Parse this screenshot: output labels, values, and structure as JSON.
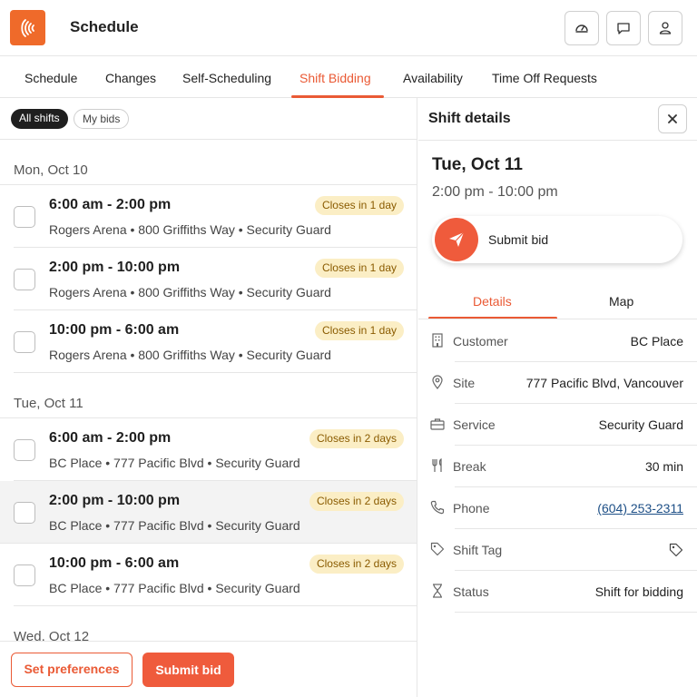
{
  "header": {
    "title": "Schedule",
    "brand_color": "#ef6a2a",
    "icons": [
      "dashboard-icon",
      "chat-icon",
      "profile-icon"
    ]
  },
  "tabs": [
    {
      "label": "Schedule",
      "active": false
    },
    {
      "label": "Changes",
      "active": false
    },
    {
      "label": "Self-Scheduling",
      "active": false
    },
    {
      "label": "Shift Bidding",
      "active": true
    },
    {
      "label": "Availability",
      "active": false
    },
    {
      "label": "Time Off Requests",
      "active": false
    }
  ],
  "filters": {
    "all_label": "All shifts",
    "mine_label": "My bids",
    "selected": "All shifts"
  },
  "days": [
    {
      "label": "Mon, Oct 10",
      "shifts": [
        {
          "time": "6:00 am - 2:00 pm",
          "meta": "Rogers Arena • 800 Griffiths Way • Security Guard",
          "badge": "Closes in 1 day",
          "selected": false
        },
        {
          "time": "2:00 pm - 10:00 pm",
          "meta": "Rogers Arena • 800 Griffiths Way • Security Guard",
          "badge": "Closes in 1 day",
          "selected": false
        },
        {
          "time": "10:00 pm - 6:00 am",
          "meta": "Rogers Arena • 800 Griffiths Way • Security Guard",
          "badge": "Closes in 1 day",
          "selected": false
        }
      ]
    },
    {
      "label": "Tue, Oct 11",
      "shifts": [
        {
          "time": "6:00 am - 2:00 pm",
          "meta": "BC Place • 777 Pacific Blvd • Security Guard",
          "badge": "Closes in 2 days",
          "selected": false
        },
        {
          "time": "2:00 pm - 10:00 pm",
          "meta": "BC Place • 777 Pacific Blvd • Security Guard",
          "badge": "Closes in 2 days",
          "selected": true
        },
        {
          "time": "10:00 pm - 6:00 am",
          "meta": "BC Place • 777 Pacific Blvd • Security Guard",
          "badge": "Closes in 2 days",
          "selected": false
        }
      ]
    },
    {
      "label": "Wed, Oct 12",
      "shifts": []
    }
  ],
  "footer": {
    "preferences_label": "Set preferences",
    "submit_label": "Submit bid"
  },
  "details": {
    "title": "Shift details",
    "date": "Tue, Oct 11",
    "time": "2:00 pm - 10:00 pm",
    "submit_label": "Submit bid",
    "tabs": [
      {
        "label": "Details",
        "active": true
      },
      {
        "label": "Map",
        "active": false
      }
    ],
    "rows": [
      {
        "icon": "building-icon",
        "label": "Customer",
        "value": "BC Place"
      },
      {
        "icon": "location-pin-icon",
        "label": "Site",
        "value": "777 Pacific Blvd, Vancouver"
      },
      {
        "icon": "briefcase-icon",
        "label": "Service",
        "value": "Security Guard"
      },
      {
        "icon": "utensils-icon",
        "label": "Break",
        "value": "30 min"
      },
      {
        "icon": "phone-icon",
        "label": "Phone",
        "value": "(604) 253-2311"
      },
      {
        "icon": "tag-icon",
        "label": "Shift Tag",
        "value": ""
      },
      {
        "icon": "hourglass-icon",
        "label": "Status",
        "value": "Shift for bidding"
      }
    ]
  },
  "colors": {
    "accent": "#ea5a35",
    "badge_bg": "#fbeec5",
    "badge_text": "#8a5b00",
    "link": "#1d4f86"
  }
}
